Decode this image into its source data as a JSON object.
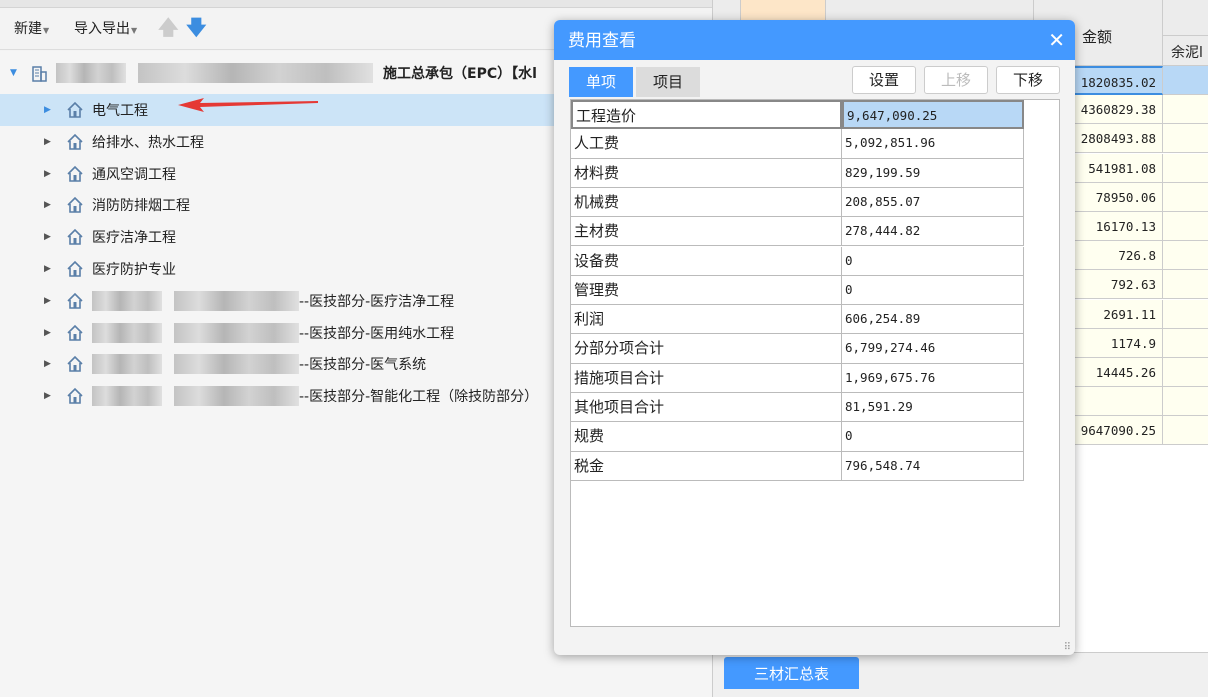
{
  "toolbar": {
    "new": "新建",
    "import_export": "导入导出"
  },
  "tree": {
    "root_suffix": "施工总承包（EPC）【水l",
    "items": [
      {
        "label": "电气工程"
      },
      {
        "label": "给排水、热水工程"
      },
      {
        "label": "通风空调工程"
      },
      {
        "label": "消防防排烟工程"
      },
      {
        "label": "医疗洁净工程"
      },
      {
        "label": "医疗防护专业"
      },
      {
        "label": "--医技部分-医疗洁净工程"
      },
      {
        "label": "--医技部分-医用纯水工程"
      },
      {
        "label": "--医技部分-医气系统"
      },
      {
        "label": "--医技部分-智能化工程（除技防部分）"
      }
    ]
  },
  "grid": {
    "col_amount": "金额",
    "col_next": "余泥l",
    "values": [
      "1820835.02",
      "4360829.38",
      "2808493.88",
      "541981.08",
      "78950.06",
      "16170.13",
      "726.8",
      "792.63",
      "2691.11",
      "1174.9",
      "14445.26",
      "",
      "9647090.25"
    ]
  },
  "dialog": {
    "title": "费用查看",
    "tabs": [
      "单项",
      "项目"
    ],
    "buttons": {
      "settings": "设置",
      "move_up": "上移",
      "move_down": "下移"
    },
    "rows": [
      {
        "name": "工程造价",
        "value": "9,647,090.25"
      },
      {
        "name": "人工费",
        "value": "5,092,851.96"
      },
      {
        "name": "材料费",
        "value": "829,199.59"
      },
      {
        "name": "机械费",
        "value": "208,855.07"
      },
      {
        "name": "主材费",
        "value": "278,444.82"
      },
      {
        "name": "设备费",
        "value": "0"
      },
      {
        "name": "管理费",
        "value": "0"
      },
      {
        "name": "利润",
        "value": "606,254.89"
      },
      {
        "name": "分部分项合计",
        "value": "6,799,274.46"
      },
      {
        "name": "措施项目合计",
        "value": "1,969,675.76"
      },
      {
        "name": "其他项目合计",
        "value": "81,591.29"
      },
      {
        "name": "规费",
        "value": "0"
      },
      {
        "name": "税金",
        "value": "796,548.74"
      }
    ]
  },
  "bottom_tab": "三材汇总表"
}
